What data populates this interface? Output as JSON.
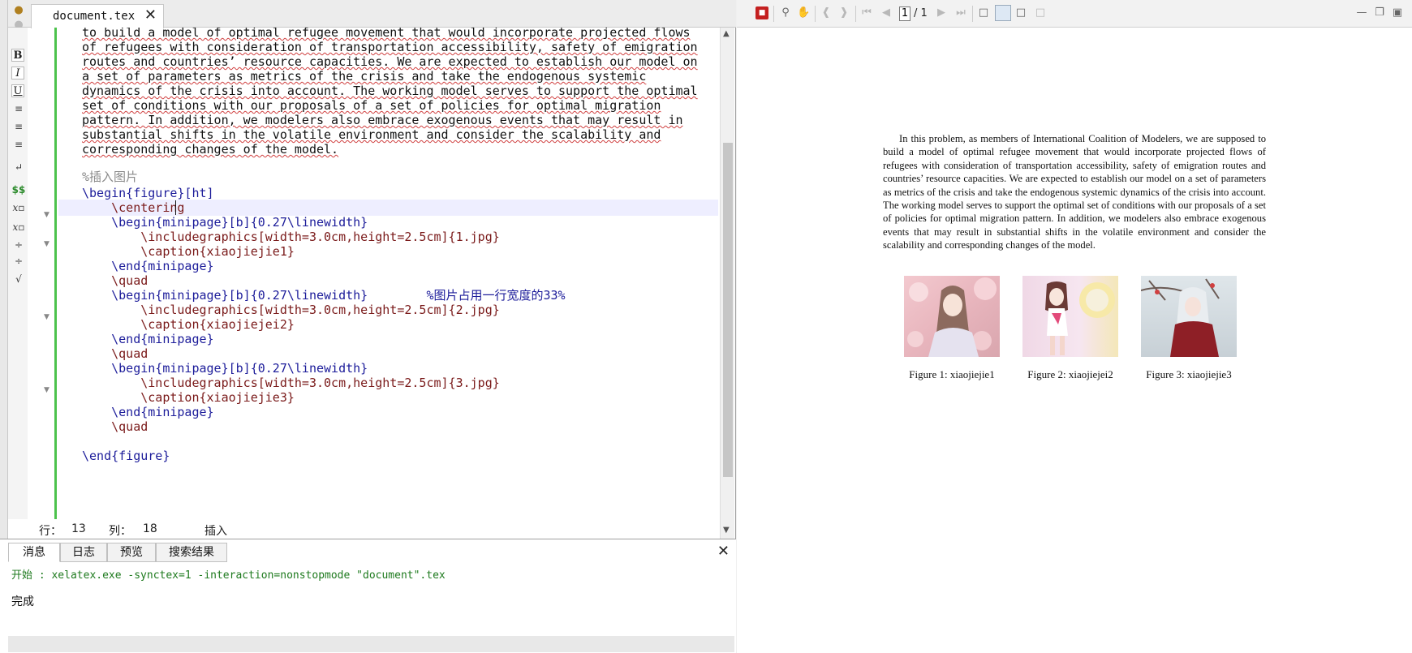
{
  "editor": {
    "tab_label": "document.tex",
    "format_buttons": [
      "B",
      "I",
      "U"
    ],
    "math_button": "$$",
    "lines": [
      "to build a model of optimal refugee movement that would incorporate projected flows",
      "of refugees with consideration of transportation accessibility, safety of emigration",
      "routes and countries’ resource capacities. We are expected to establish our model on",
      "a set of parameters as metrics of the crisis and take the endogenous systemic",
      "dynamics of the crisis into account. The working model serves to support the optimal",
      "set of conditions with our proposals of a set of policies for optimal migration",
      "pattern. In addition, we modelers also embrace exogenous events that may result in",
      "substantial shifts in the volatile environment and consider the scalability and",
      "corresponding changes of the model.",
      "",
      "%插入图片",
      "\\begin{figure}[ht]",
      "    \\centering",
      "    \\begin{minipage}[b]{0.27\\linewidth}",
      "        \\includegraphics[width=3.0cm,height=2.5cm]{1.jpg}",
      "        \\caption{xiaojiejie1}",
      "    \\end{minipage}",
      "    \\quad",
      "    \\begin{minipage}[b]{0.27\\linewidth}        %图片占用一行宽度的33%",
      "        \\includegraphics[width=3.0cm,height=2.5cm]{2.jpg}",
      "        \\caption{xiaojiejei2}",
      "    \\end{minipage}",
      "    \\quad",
      "    \\begin{minipage}[b]{0.27\\linewidth}",
      "        \\includegraphics[width=3.0cm,height=2.5cm]{3.jpg}",
      "        \\caption{xiaojiejie3}",
      "    \\end{minipage}",
      "    \\quad",
      "",
      "\\end{figure}"
    ],
    "status": {
      "line_label": "行：",
      "line_value": "13",
      "col_label": "列：",
      "col_value": "18",
      "mode": "插入"
    }
  },
  "bottom_panel": {
    "tabs": [
      "消息",
      "日志",
      "预览",
      "搜索结果"
    ],
    "message_line": "开始 : xelatex.exe -synctex=1 -interaction=nonstopmode \"document\".tex",
    "done_line": "完成"
  },
  "viewer": {
    "page_current": "1",
    "page_total": "/ 1",
    "paragraph": "In this problem, as members of International Coalition of Modelers, we are supposed to build a model of optimal refugee movement that would incorporate projected flows of refugees with consideration of transportation accessibility, safety of emigration routes and countries’ resource capacities. We are expected to establish our model on a set of parameters as metrics of the crisis and take the endogenous systemic dynamics of the crisis into account. The working model serves to support the optimal set of conditions with our proposals of a set of policies for optimal migration pattern. In addition, we modelers also embrace exogenous events that may result in substantial shifts in the volatile environment and consider the scalability and corresponding changes of the model.",
    "captions": [
      "Figure 1: xiaojiejie1",
      "Figure 2: xiaojiejei2",
      "Figure 3: xiaojiejie3"
    ]
  }
}
